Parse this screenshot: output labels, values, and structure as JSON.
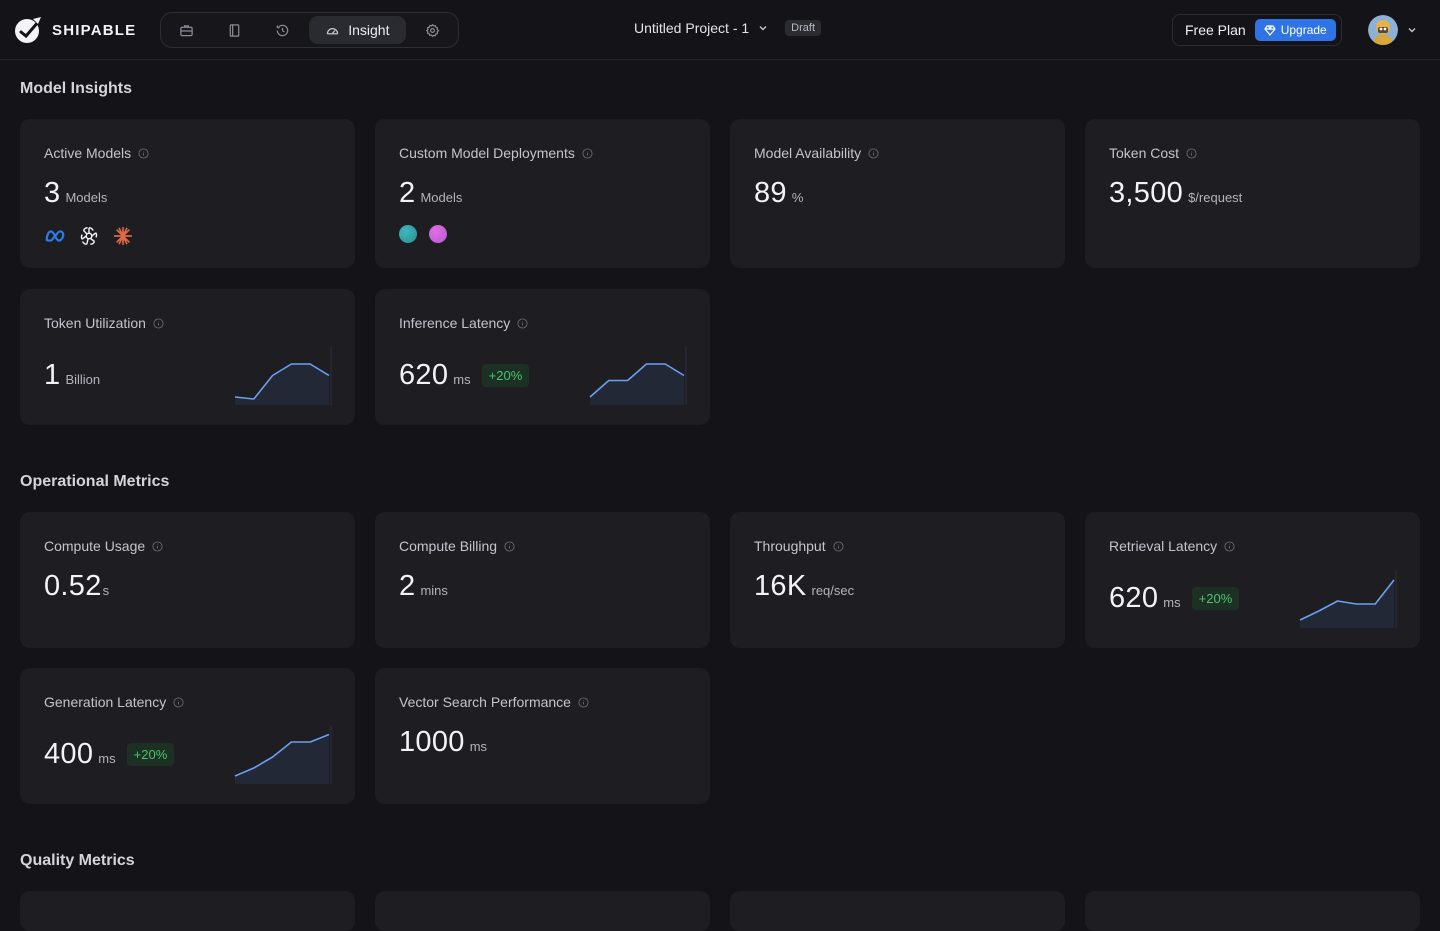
{
  "brand": {
    "name": "SHIPABLE"
  },
  "toolbar": {
    "items": [
      {
        "icon": "briefcase-icon"
      },
      {
        "icon": "book-icon"
      },
      {
        "icon": "history-icon"
      },
      {
        "icon": "gauge-icon",
        "label": "Insight",
        "active": true
      },
      {
        "icon": "gear-icon"
      }
    ]
  },
  "project": {
    "name": "Untitled Project - 1",
    "status": "Draft"
  },
  "plan": {
    "label": "Free Plan",
    "upgrade_label": "Upgrade"
  },
  "colors": {
    "accent": "#2f74e6",
    "positive": "#4cc36c",
    "sparkline": "#6aa0ef"
  },
  "sections": {
    "model_insights": {
      "title": "Model Insights",
      "cards": {
        "active_models": {
          "title": "Active Models",
          "value": "3",
          "unit": "Models",
          "logos": [
            "meta-logo-icon",
            "openai-logo-icon",
            "anthropic-logo-icon"
          ]
        },
        "custom_deployments": {
          "title": "Custom Model Deployments",
          "value": "2",
          "unit": "Models",
          "dots": [
            "#3fb8c4",
            "#e06fe0"
          ]
        },
        "availability": {
          "title": "Model Availability",
          "value": "89",
          "unit": "%"
        },
        "token_cost": {
          "title": "Token Cost",
          "value": "3,500",
          "unit": "$/request"
        },
        "token_utilization": {
          "title": "Token Utilization",
          "value": "1",
          "unit": "Billion",
          "trend": [
            0.12,
            0.08,
            0.55,
            0.78,
            0.78,
            0.55
          ]
        },
        "inference_latency": {
          "title": "Inference Latency",
          "value": "620",
          "unit": "ms",
          "delta": "+20%",
          "trend": [
            0.12,
            0.45,
            0.45,
            0.78,
            0.78,
            0.55
          ]
        }
      }
    },
    "operational_metrics": {
      "title": "Operational Metrics",
      "cards": {
        "compute_usage": {
          "title": "Compute Usage",
          "value": "0.52",
          "unit": "s"
        },
        "compute_billing": {
          "title": "Compute Billing",
          "value": "2",
          "unit": "mins"
        },
        "throughput": {
          "title": "Throughput",
          "value": "16K",
          "unit": "req/sec"
        },
        "retrieval_latency": {
          "title": "Retrieval Latency",
          "value": "620",
          "unit": "ms",
          "delta": "+20%",
          "trend": [
            0.12,
            0.3,
            0.5,
            0.44,
            0.44,
            0.92
          ]
        },
        "generation_latency": {
          "title": "Generation Latency",
          "value": "400",
          "unit": "ms",
          "delta": "+20%",
          "trend": [
            0.12,
            0.28,
            0.5,
            0.8,
            0.8,
            0.95
          ]
        },
        "vector_search": {
          "title": "Vector Search Performance",
          "value": "1000",
          "unit": "ms"
        }
      }
    },
    "quality_metrics": {
      "title": "Quality Metrics"
    }
  }
}
